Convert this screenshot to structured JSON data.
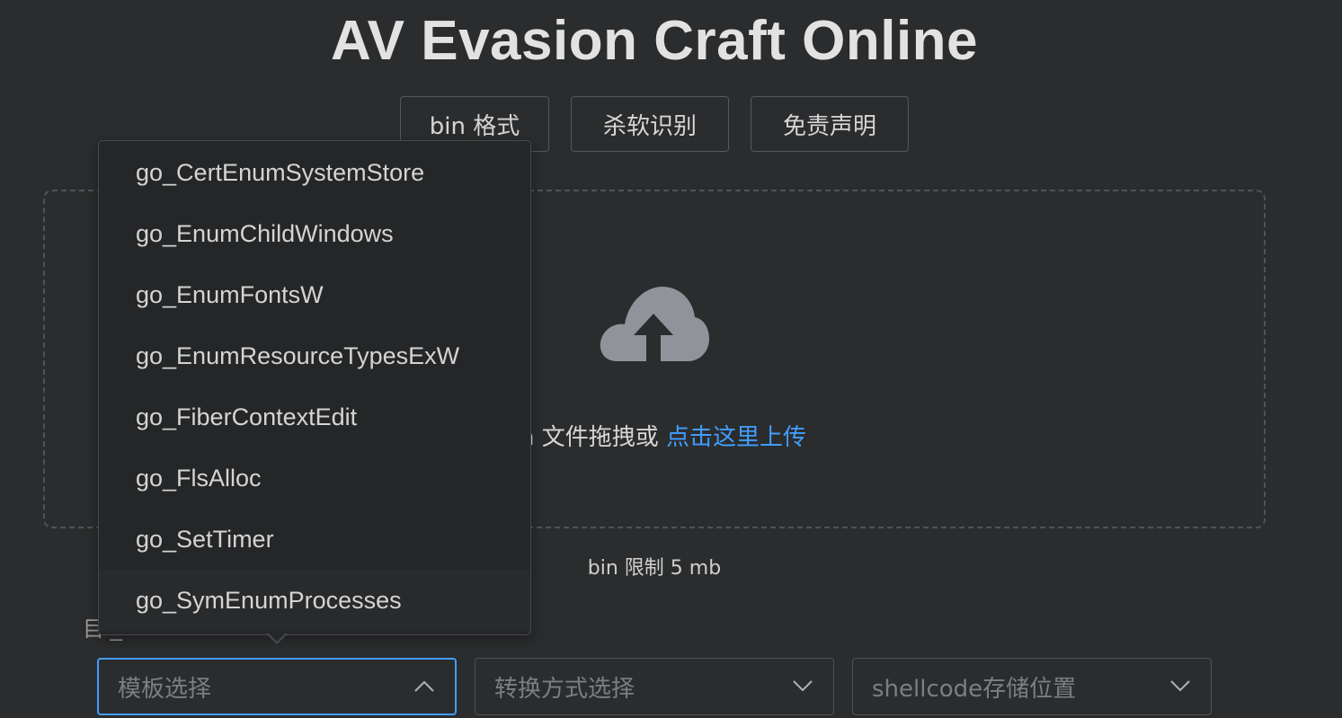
{
  "header": {
    "title": "AV Evasion Craft Online"
  },
  "toolbar": {
    "bin_format_label": "bin 格式",
    "av_detect_label": "杀软识别",
    "disclaimer_label": "免责声明"
  },
  "upload": {
    "text_prefix": "n 文件拖拽或 ",
    "link_text": "点击这里上传",
    "limit_text": "bin 限制 5 mb"
  },
  "form": {
    "partial_label": "目  _",
    "template_select": {
      "placeholder": "模板选择"
    },
    "convert_select": {
      "placeholder": "转换方式选择"
    },
    "storage_select": {
      "placeholder": "shellcode存储位置"
    }
  },
  "dropdown": {
    "options": [
      {
        "label": "go_CertEnumSystemStore"
      },
      {
        "label": "go_EnumChildWindows"
      },
      {
        "label": "go_EnumFontsW"
      },
      {
        "label": "go_EnumResourceTypesExW"
      },
      {
        "label": "go_FiberContextEdit"
      },
      {
        "label": "go_FlsAlloc"
      },
      {
        "label": "go_SetTimer"
      },
      {
        "label": "go_SymEnumProcesses"
      }
    ]
  },
  "icons": {
    "upload": "cloud-upload-icon",
    "chevron_up": "chevron-up-icon",
    "chevron_down": "chevron-down-icon"
  },
  "colors": {
    "background": "#2b2c2d",
    "accent": "#409eff",
    "text": "#d6d6d6",
    "placeholder": "#7c7e82"
  }
}
